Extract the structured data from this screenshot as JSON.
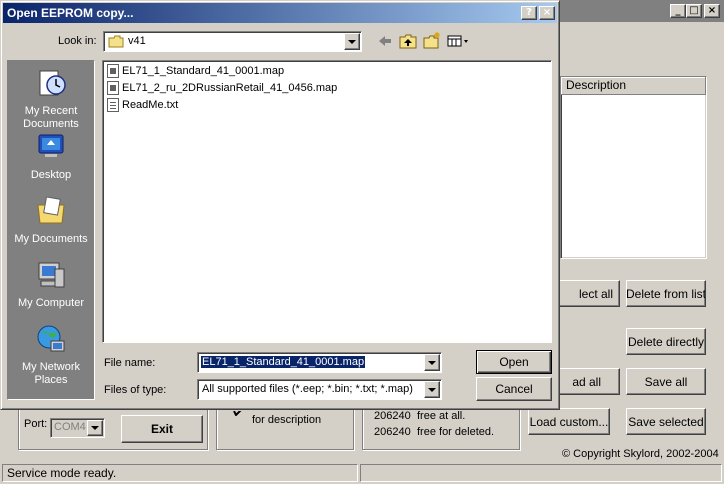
{
  "background_window": {
    "caption_buttons": [
      "_",
      "□",
      "×"
    ],
    "listview_column": "Description",
    "buttons": {
      "select_all": "lect all",
      "delete_from_list": "Delete from list",
      "delete_directly": "Delete directly",
      "load_all": "ad all",
      "save_all": "Save all",
      "load_custom": "Load custom...",
      "save_selected": "Save selected",
      "exit": "Exit"
    },
    "port_label": "Port:",
    "port_value": "COM4",
    "description_checkbox_label": "for description",
    "free_at_all_value": "206240",
    "free_at_all_label": "free at all.",
    "free_deleted_value": "206240",
    "free_deleted_label": "free for deleted.",
    "copyright": "© Copyright Skylord, 2002-2004",
    "status_text": "Service mode ready."
  },
  "dialog": {
    "title": "Open EEPROM copy...",
    "help_button": "?",
    "close_button": "×",
    "look_in_label": "Look in:",
    "look_in_value": "v41",
    "places": [
      {
        "label": "My Recent Documents",
        "icon": "recent-documents-icon"
      },
      {
        "label": "Desktop",
        "icon": "desktop-icon"
      },
      {
        "label": "My Documents",
        "icon": "my-documents-icon"
      },
      {
        "label": "My Computer",
        "icon": "my-computer-icon"
      },
      {
        "label": "My Network Places",
        "icon": "network-places-icon"
      }
    ],
    "files": [
      {
        "name": "EL71_1_Standard_41_0001.map",
        "icon": "map-file-icon"
      },
      {
        "name": "EL71_2_ru_2DRussianRetail_41_0456.map",
        "icon": "map-file-icon"
      },
      {
        "name": "ReadMe.txt",
        "icon": "text-file-icon"
      }
    ],
    "file_name_label": "File name:",
    "file_name_value": "EL71_1_Standard_41_0001.map",
    "files_of_type_label": "Files of type:",
    "files_of_type_value": "All supported files (*.eep; *.bin; *.txt; *.map)",
    "open_button": "Open",
    "cancel_button": "Cancel",
    "colors": {
      "title_start": "#0a246a",
      "title_end": "#a6caf0",
      "selection": "#0a246a",
      "places_bg": "#808080"
    }
  }
}
